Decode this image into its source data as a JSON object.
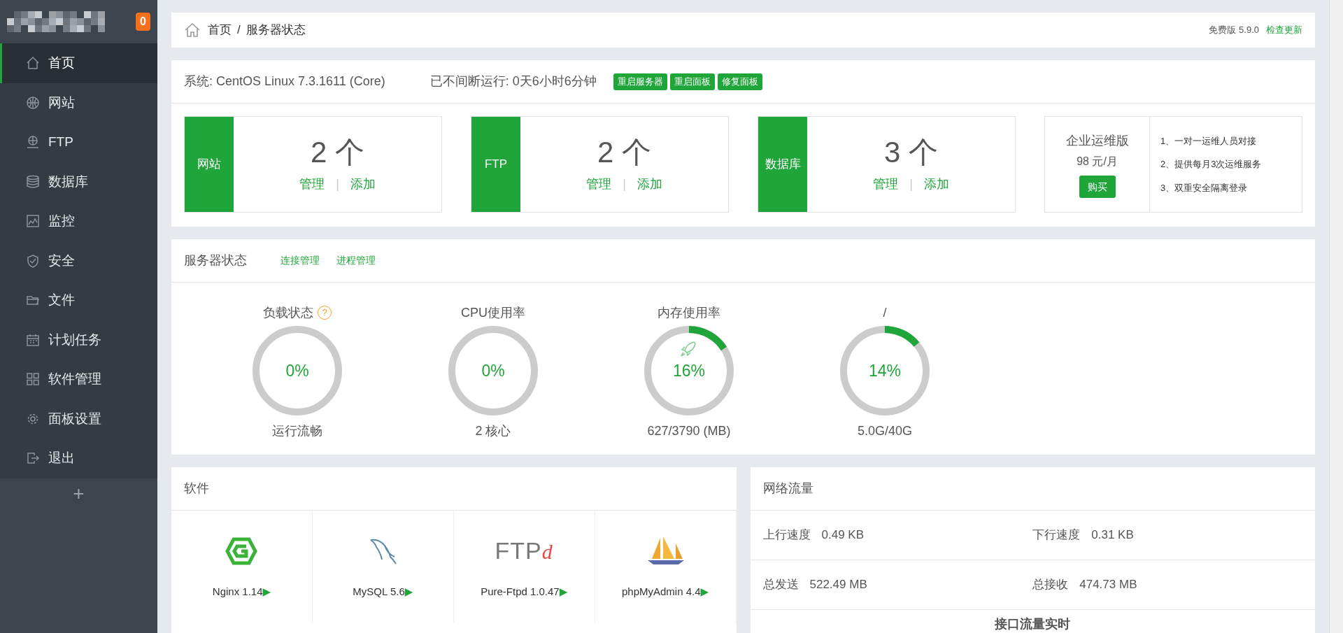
{
  "sidebar": {
    "badge": "0",
    "items": [
      {
        "label": "首页",
        "kind": "home",
        "selected": true
      },
      {
        "label": "网站",
        "kind": "globe",
        "selected": false
      },
      {
        "label": "FTP",
        "kind": "ftp",
        "selected": false
      },
      {
        "label": "数据库",
        "kind": "database",
        "selected": false
      },
      {
        "label": "监控",
        "kind": "monitor",
        "selected": false
      },
      {
        "label": "安全",
        "kind": "shield",
        "selected": false
      },
      {
        "label": "文件",
        "kind": "folder",
        "selected": false
      },
      {
        "label": "计划任务",
        "kind": "calendar",
        "selected": false
      },
      {
        "label": "软件管理",
        "kind": "apps",
        "selected": false
      },
      {
        "label": "面板设置",
        "kind": "gear",
        "selected": false
      },
      {
        "label": "退出",
        "kind": "logout",
        "selected": false
      }
    ],
    "add": "+"
  },
  "breadcrumb": {
    "items": [
      "首页",
      "服务器状态"
    ],
    "separator": "/",
    "version": "免费版 5.9.0",
    "update_link": "检查更新"
  },
  "system": {
    "os": "系统: CentOS Linux 7.3.1611 (Core)",
    "uptime": "已不间断运行: 0天6小时6分钟",
    "buttons": [
      "重启服务器",
      "重启面板",
      "修复面板"
    ]
  },
  "stats": [
    {
      "label": "网站",
      "count": "2 个",
      "links": [
        "管理",
        "添加"
      ],
      "separator": "|"
    },
    {
      "label": "FTP",
      "count": "2 个",
      "links": [
        "管理",
        "添加"
      ],
      "separator": "|"
    },
    {
      "label": "数据库",
      "count": "3 个",
      "links": [
        "管理",
        "添加"
      ],
      "separator": "|"
    }
  ],
  "promo": {
    "title": "企业运维版",
    "price": "98 元/月",
    "button": "购买",
    "features": [
      "1、一对一运维人员对接",
      "2、提供每月3次运维服务",
      "3、双重安全隔离登录"
    ]
  },
  "server_status": {
    "title": "服务器状态",
    "links": [
      "连接管理",
      "进程管理"
    ],
    "gauges": [
      {
        "kind": "load",
        "title": "负载状态",
        "help": "?",
        "level": 0,
        "value": "0%",
        "caption": "运行流畅"
      },
      {
        "kind": "cpu",
        "title": "CPU使用率",
        "level": 0,
        "value": "0%",
        "caption": "2 核心"
      },
      {
        "kind": "memory",
        "title": "内存使用率",
        "level": 0.16,
        "value": "16%",
        "caption": "627/3790 (MB)"
      },
      {
        "kind": "disk",
        "title": "/",
        "level": 0.14,
        "value": "14%",
        "caption": "5.0G/40G"
      }
    ]
  },
  "software": {
    "title": "软件",
    "items": [
      {
        "kind": "hexagon",
        "name": "Nginx 1.14",
        "arrow": "▶"
      },
      {
        "kind": "dolphin",
        "name": "MySQL 5.6",
        "arrow": "▶"
      },
      {
        "kind": "wordmark",
        "logo_text": [
          "FTP",
          "d"
        ],
        "name": "Pure-Ftpd 1.0.47",
        "arrow": "▶"
      },
      {
        "kind": "sailboat",
        "name": "phpMyAdmin 4.4",
        "arrow": "▶"
      }
    ]
  },
  "network": {
    "title": "网络流量",
    "rows": [
      [
        {
          "label": "上行速度",
          "value": "0.49 KB"
        },
        {
          "label": "下行速度",
          "value": "0.31 KB"
        }
      ],
      [
        {
          "label": "总发送",
          "value": "522.49 MB"
        },
        {
          "label": "总接收",
          "value": "474.73 MB"
        }
      ]
    ],
    "chart_title": "接口流量实时"
  }
}
